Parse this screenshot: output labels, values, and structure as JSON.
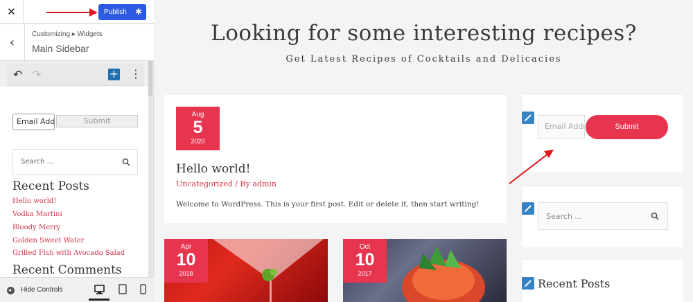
{
  "customizer": {
    "close_icon": "close-icon",
    "publish_label": "Publish",
    "publish_gear_icon": "gear-icon",
    "breadcrumb": "Customizing ▸ Widgets",
    "section_title": "Main Sidebar",
    "editor": {
      "email_placeholder": "Email Address",
      "submit_label": "Submit",
      "search_placeholder": "Search ...",
      "recent_posts_heading": "Recent Posts",
      "recent_posts": [
        "Hello world!",
        "Vodka Martini",
        "Bloody Merry",
        "Golden Sweet Water",
        "Grilled Fish with Avocado Salad"
      ],
      "recent_comments_heading": "Recent Comments"
    },
    "footer": {
      "hide_controls_label": "Hide Controls"
    }
  },
  "preview": {
    "hero_title": "Looking for some interesting recipes?",
    "hero_subtitle": "Get Latest Recipes of Cocktails and Delicacies",
    "post": {
      "date_month": "Aug",
      "date_day": "5",
      "date_year": "2020",
      "title": "Hello world!",
      "category": "Uncategorized",
      "by": "/ By",
      "author": "admin",
      "excerpt": "Welcome to WordPress. This is your first post. Edit or delete it, then start writing!"
    },
    "thumbs": [
      {
        "month": "Apr",
        "day": "10",
        "year": "2018"
      },
      {
        "month": "Oct",
        "day": "10",
        "year": "2017"
      }
    ],
    "sidebar": {
      "email_placeholder": "Email Address",
      "submit_label": "Submit",
      "search_placeholder": "Search ...",
      "recent_posts_title": "Recent Posts"
    }
  },
  "colors": {
    "accent_red": "#e7344f",
    "publish_blue": "#2c5ae0",
    "edit_pencil_blue": "#3582c4"
  }
}
